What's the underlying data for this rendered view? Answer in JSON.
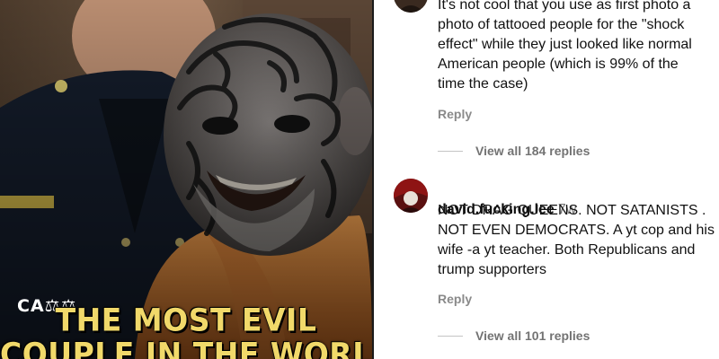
{
  "media": {
    "watermark": "CA⚖⚖",
    "headline_lines": [
      "THE MOST EVIL",
      "COUPLE IN THE WORLD"
    ],
    "colors": {
      "headline": "#f1d96a",
      "jumpsuit": "#e58a3c",
      "uniform": "#141c2a"
    }
  },
  "comments": [
    {
      "username": "",
      "time": "",
      "text": "It's not cool that you use as first photo a\nphoto of tattooed people for the \"shock\neffect\" while they just looked like normal\nAmerican people (which is 99% of the\ntime the case)",
      "reply_label": "Reply",
      "view_replies": "View all 184 replies"
    },
    {
      "username": "david.fucking.lee",
      "time": "7w",
      "text": "NOT DRAG QUEENS. NOT SATANISTS .\nNOT EVEN DEMOCRATS. A yt cop and his\nwife -a yt teacher. Both Republicans and\ntrump supporters",
      "reply_label": "Reply",
      "view_replies": "View all 101 replies"
    }
  ]
}
